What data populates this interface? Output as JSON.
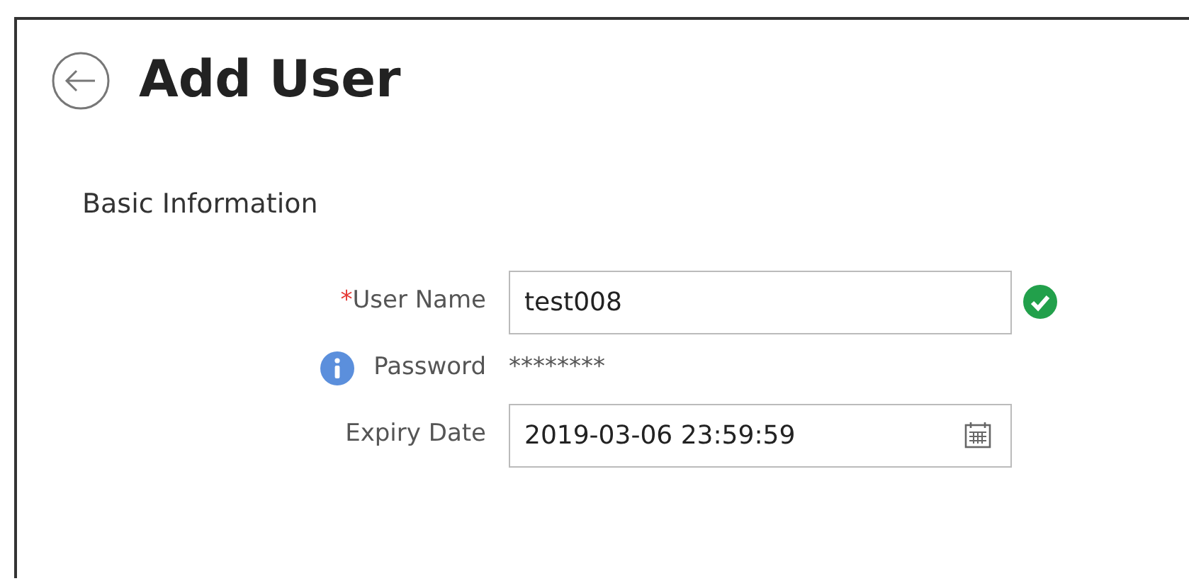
{
  "header": {
    "title": "Add User"
  },
  "section": {
    "title": "Basic Information"
  },
  "fields": [
    {
      "kind": "input",
      "required_mark": "*",
      "label": "User Name",
      "value": "test008",
      "valid": true,
      "info": false
    },
    {
      "kind": "text",
      "label": "Password",
      "value": "********",
      "valid": false,
      "info": true
    },
    {
      "kind": "date",
      "label": "Expiry Date",
      "value": "2019-03-06 23:59:59",
      "valid": false,
      "info": false
    }
  ]
}
